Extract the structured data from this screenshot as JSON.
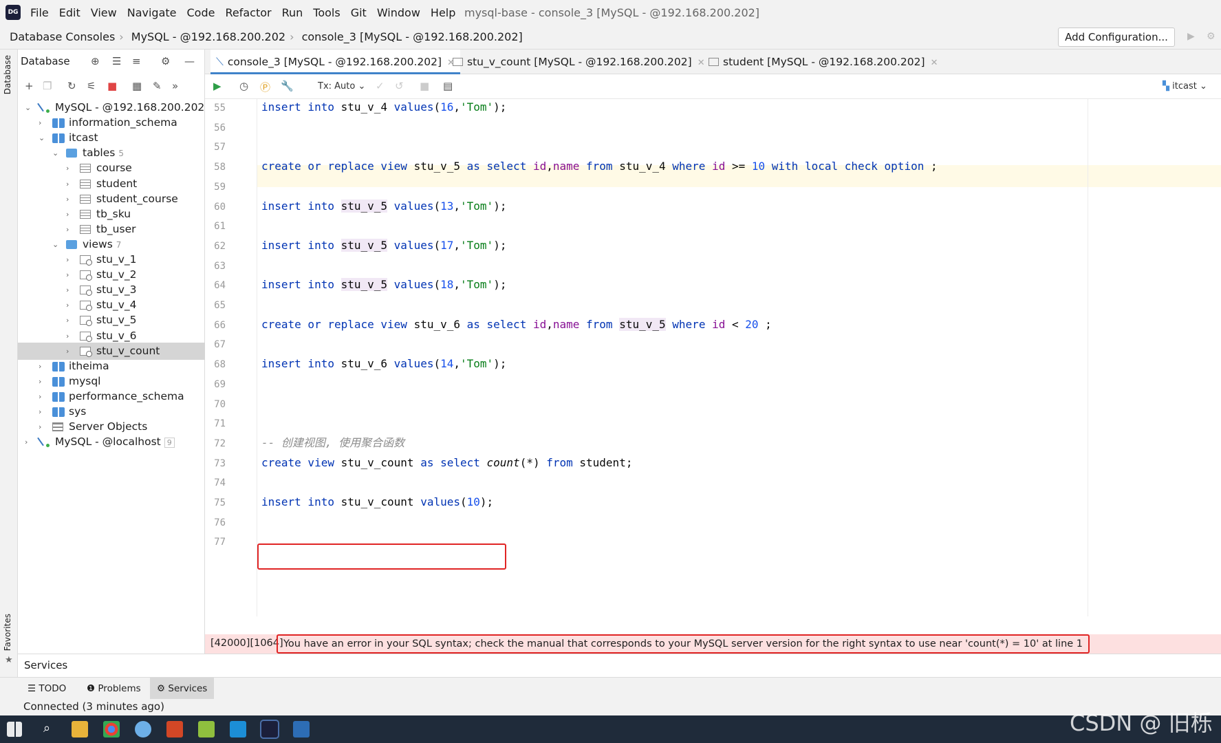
{
  "app": {
    "logo": "DG",
    "menu": [
      "File",
      "Edit",
      "View",
      "Navigate",
      "Code",
      "Refactor",
      "Run",
      "Tools",
      "Git",
      "Window",
      "Help"
    ],
    "window_title": "mysql-base - console_3 [MySQL - @192.168.200.202]"
  },
  "breadcrumb": [
    "Database Consoles",
    "MySQL - @192.168.200.202",
    "console_3 [MySQL - @192.168.200.202]"
  ],
  "add_config_label": "Add Configuration...",
  "side_strip": {
    "database_tab": "Database",
    "favorites_tab": "Favorites"
  },
  "db_panel": {
    "title": "Database",
    "tree": [
      {
        "level": 0,
        "label": "MySQL - @192.168.200.202",
        "icon": "connection-icon",
        "expanded": true
      },
      {
        "level": 1,
        "label": "information_schema",
        "icon": "schema-icon",
        "expanded": false
      },
      {
        "level": 1,
        "label": "itcast",
        "icon": "schema-icon",
        "expanded": true
      },
      {
        "level": 2,
        "label": "tables",
        "count": "5",
        "icon": "folder-icon",
        "expanded": true
      },
      {
        "level": 3,
        "label": "course",
        "icon": "table-icon"
      },
      {
        "level": 3,
        "label": "student",
        "icon": "table-icon"
      },
      {
        "level": 3,
        "label": "student_course",
        "icon": "table-icon"
      },
      {
        "level": 3,
        "label": "tb_sku",
        "icon": "table-icon"
      },
      {
        "level": 3,
        "label": "tb_user",
        "icon": "table-icon"
      },
      {
        "level": 2,
        "label": "views",
        "count": "7",
        "icon": "folder-icon",
        "expanded": true
      },
      {
        "level": 3,
        "label": "stu_v_1",
        "icon": "view-icon"
      },
      {
        "level": 3,
        "label": "stu_v_2",
        "icon": "view-icon"
      },
      {
        "level": 3,
        "label": "stu_v_3",
        "icon": "view-icon"
      },
      {
        "level": 3,
        "label": "stu_v_4",
        "icon": "view-icon"
      },
      {
        "level": 3,
        "label": "stu_v_5",
        "icon": "view-icon"
      },
      {
        "level": 3,
        "label": "stu_v_6",
        "icon": "view-icon"
      },
      {
        "level": 3,
        "label": "stu_v_count",
        "icon": "view-icon",
        "selected": true
      },
      {
        "level": 1,
        "label": "itheima",
        "icon": "schema-icon"
      },
      {
        "level": 1,
        "label": "mysql",
        "icon": "schema-icon"
      },
      {
        "level": 1,
        "label": "performance_schema",
        "icon": "schema-icon"
      },
      {
        "level": 1,
        "label": "sys",
        "icon": "schema-icon"
      },
      {
        "level": 1,
        "label": "Server Objects",
        "icon": "server-objects-icon"
      },
      {
        "level": 0,
        "label": "MySQL - @localhost",
        "count": "9",
        "icon": "connection-icon"
      }
    ]
  },
  "tabs": [
    {
      "label": "console_3 [MySQL - @192.168.200.202]",
      "active": true,
      "icon": "console-icon"
    },
    {
      "label": "stu_v_count [MySQL - @192.168.200.202]",
      "active": false,
      "icon": "view-icon"
    },
    {
      "label": "student [MySQL - @192.168.200.202]",
      "active": false,
      "icon": "table-icon"
    }
  ],
  "editor_toolbar": {
    "tx_mode": "Tx: Auto",
    "schema": "itcast"
  },
  "editor": {
    "line_numbers": [
      "55",
      "56",
      "57",
      "58",
      "59",
      "60",
      "61",
      "62",
      "63",
      "64",
      "65",
      "66",
      "67",
      "68",
      "69",
      "70",
      "71",
      "72",
      "73",
      "74",
      "75",
      "76",
      "77"
    ],
    "lines": [
      {
        "ln": "55",
        "tokens": [
          [
            "kw",
            "insert into "
          ],
          [
            "",
            "stu_v_4 "
          ],
          [
            "kw",
            "values"
          ],
          [
            "",
            "("
          ],
          [
            "num",
            "16"
          ],
          [
            "",
            ","
          ],
          [
            "str",
            "'Tom'"
          ],
          [
            "",
            ");"
          ]
        ]
      },
      {
        "ln": "58",
        "tokens": [
          [
            "kw",
            "create or replace view "
          ],
          [
            "",
            "stu_v_5 "
          ],
          [
            "kw",
            "as select "
          ],
          [
            "fld",
            "id"
          ],
          [
            "",
            ","
          ],
          [
            "fld",
            "name "
          ],
          [
            "kw",
            "from "
          ],
          [
            "",
            "stu_v_4 "
          ],
          [
            "kw",
            "where "
          ],
          [
            "fld",
            "id "
          ],
          [
            "",
            ">= "
          ],
          [
            "num",
            "10 "
          ],
          [
            "kw",
            "with local check option "
          ],
          [
            "",
            ";"
          ]
        ]
      },
      {
        "ln": "60",
        "tokens": [
          [
            "kw",
            "insert into "
          ],
          [
            "tok",
            "stu_v_5"
          ],
          [
            "",
            " "
          ],
          [
            "kw",
            "values"
          ],
          [
            "",
            "("
          ],
          [
            "num",
            "13"
          ],
          [
            "",
            ","
          ],
          [
            "str",
            "'Tom'"
          ],
          [
            "",
            ");"
          ]
        ]
      },
      {
        "ln": "62",
        "tokens": [
          [
            "kw",
            "insert into "
          ],
          [
            "tok",
            "stu_v_5"
          ],
          [
            "",
            " "
          ],
          [
            "kw",
            "values"
          ],
          [
            "",
            "("
          ],
          [
            "num",
            "17"
          ],
          [
            "",
            ","
          ],
          [
            "str",
            "'Tom'"
          ],
          [
            "",
            ");"
          ]
        ]
      },
      {
        "ln": "64",
        "tokens": [
          [
            "kw",
            "insert into "
          ],
          [
            "tok",
            "stu_v_5"
          ],
          [
            "",
            " "
          ],
          [
            "kw",
            "values"
          ],
          [
            "",
            "("
          ],
          [
            "num",
            "18"
          ],
          [
            "",
            ","
          ],
          [
            "str",
            "'Tom'"
          ],
          [
            "",
            ");"
          ]
        ]
      },
      {
        "ln": "66",
        "tokens": [
          [
            "kw",
            "create or replace view "
          ],
          [
            "",
            "stu_v_6 "
          ],
          [
            "kw",
            "as select "
          ],
          [
            "fld",
            "id"
          ],
          [
            "",
            ","
          ],
          [
            "fld",
            "name "
          ],
          [
            "kw",
            "from "
          ],
          [
            "tok",
            "stu_v_5"
          ],
          [
            "",
            " "
          ],
          [
            "kw",
            "where "
          ],
          [
            "fld",
            "id "
          ],
          [
            "",
            "< "
          ],
          [
            "num",
            "20 "
          ],
          [
            "",
            ";"
          ]
        ]
      },
      {
        "ln": "68",
        "tokens": [
          [
            "kw",
            "insert into "
          ],
          [
            "",
            "stu_v_6 "
          ],
          [
            "kw",
            "values"
          ],
          [
            "",
            "("
          ],
          [
            "num",
            "14"
          ],
          [
            "",
            ","
          ],
          [
            "str",
            "'Tom'"
          ],
          [
            "",
            ");"
          ]
        ]
      },
      {
        "ln": "72",
        "tokens": [
          [
            "cmt",
            "-- 创建视图, 使用聚合函数"
          ]
        ]
      },
      {
        "ln": "73",
        "tokens": [
          [
            "kw",
            "create view "
          ],
          [
            "",
            "stu_v_count "
          ],
          [
            "kw",
            "as select "
          ],
          [
            "fn",
            "count"
          ],
          [
            "",
            "(*) "
          ],
          [
            "kw",
            "from "
          ],
          [
            "",
            "student;"
          ]
        ]
      },
      {
        "ln": "75",
        "tokens": [
          [
            "kw",
            "insert into "
          ],
          [
            "",
            "stu_v_count "
          ],
          [
            "kw",
            "values"
          ],
          [
            "",
            "("
          ],
          [
            "num",
            "10"
          ],
          [
            "",
            ");"
          ]
        ]
      }
    ]
  },
  "error": {
    "code": "[42000][1064]",
    "message": "You have an error in your SQL syntax; check the manual that corresponds to your MySQL server version for the right syntax to use near 'count(*) = 10' at line 1"
  },
  "services_title": "Services",
  "bottom_tabs": [
    {
      "label": "TODO",
      "icon": "list-icon"
    },
    {
      "label": "Problems",
      "icon": "info-icon"
    },
    {
      "label": "Services",
      "icon": "services-icon",
      "active": true
    }
  ],
  "status": "Connected (3 minutes ago)",
  "watermark": "CSDN @ 旧栎"
}
